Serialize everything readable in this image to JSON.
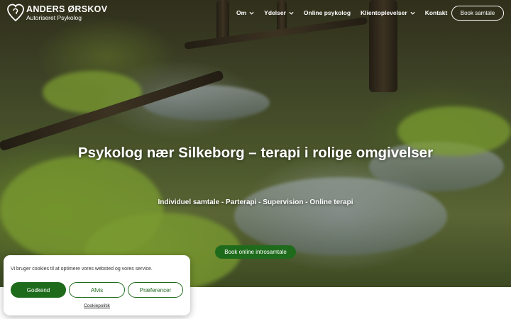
{
  "brand": {
    "name": "ANDERS ØRSKOV",
    "subtitle": "Autoriseret Psykolog"
  },
  "nav": {
    "items": [
      {
        "label": "Om",
        "has_dropdown": true
      },
      {
        "label": "Ydelser",
        "has_dropdown": true
      },
      {
        "label": "Online psykolog",
        "has_dropdown": false
      },
      {
        "label": "Klientoplevelser",
        "has_dropdown": true
      },
      {
        "label": "Kontakt",
        "has_dropdown": false
      }
    ],
    "book_button": "Book samtale"
  },
  "hero": {
    "title": "Psykolog nær Silkeborg – terapi i rolige omgivelser",
    "subtitle": "Individuel samtale - Parterapi - Supervision - Online terapi",
    "cta": "Book online introsamtale"
  },
  "cookie_banner": {
    "text": "Vi bruger cookies til at optimere vores websted og vores service.",
    "accept": "Godkend",
    "deny": "Afvis",
    "preferences": "Præferencer",
    "policy_link": "Cookiepolitik"
  },
  "colors": {
    "accent": "#1f6b1c",
    "white": "#ffffff"
  },
  "icons": {
    "logo": "heart-head-logo-icon",
    "dropdown": "chevron-down-icon"
  }
}
